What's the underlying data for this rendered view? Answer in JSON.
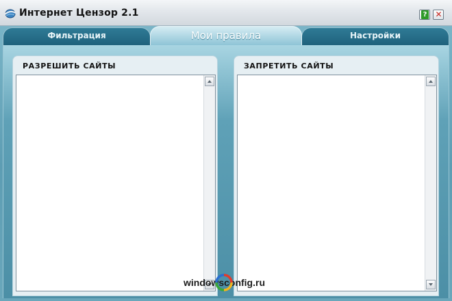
{
  "window": {
    "title": "Интернет Цензор 2.1",
    "accent": "#1f627c",
    "background": "#5d9db3"
  },
  "titlebar": {
    "help_label": "?",
    "close_label": "✕"
  },
  "tabs": [
    {
      "label": "Фильтрация",
      "active": false
    },
    {
      "label": "Мои правила",
      "active": true
    },
    {
      "label": "Настройки",
      "active": false
    }
  ],
  "panels": {
    "allow": {
      "title": "РАЗРЕШИТЬ САЙТЫ",
      "items": []
    },
    "deny": {
      "title": "ЗАПРЕТИТЬ САЙТЫ",
      "items": []
    }
  },
  "watermark": {
    "text": "windowsconfig.ru"
  }
}
